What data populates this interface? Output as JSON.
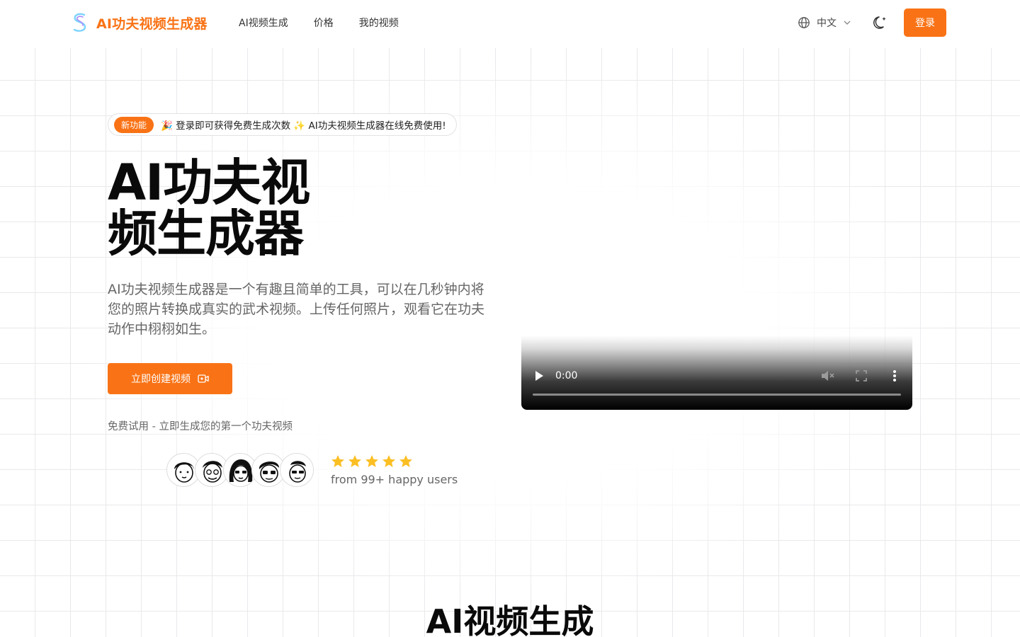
{
  "header": {
    "logo_text": "AI功夫视频生成器",
    "nav": [
      {
        "label": "AI视频生成"
      },
      {
        "label": "价格"
      },
      {
        "label": "我的视频"
      }
    ],
    "language": "中文",
    "login_label": "登录"
  },
  "hero": {
    "announce_badge": "新功能",
    "announce_text": "🎉 登录即可获得免费生成次数 ✨ AI功夫视频生成器在线免费使用!",
    "title": "AI功夫视频生成器",
    "description": "AI功夫视频生成器是一个有趣且简单的工具，可以在几秒钟内将您的照片转换成真实的武术视频。上传任何照片，观看它在功夫动作中栩栩如生。",
    "cta_label": "立即创建视频",
    "free_note": "免费试用 - 立即生成您的第一个功夫视频"
  },
  "social_proof": {
    "rating_stars": 5,
    "rating_text": "from 99+ happy users",
    "star_color": "#fbbf24"
  },
  "video": {
    "time": "0:00",
    "progress": 0
  },
  "section": {
    "title": "AI视频生成"
  },
  "colors": {
    "accent": "#f97316"
  }
}
